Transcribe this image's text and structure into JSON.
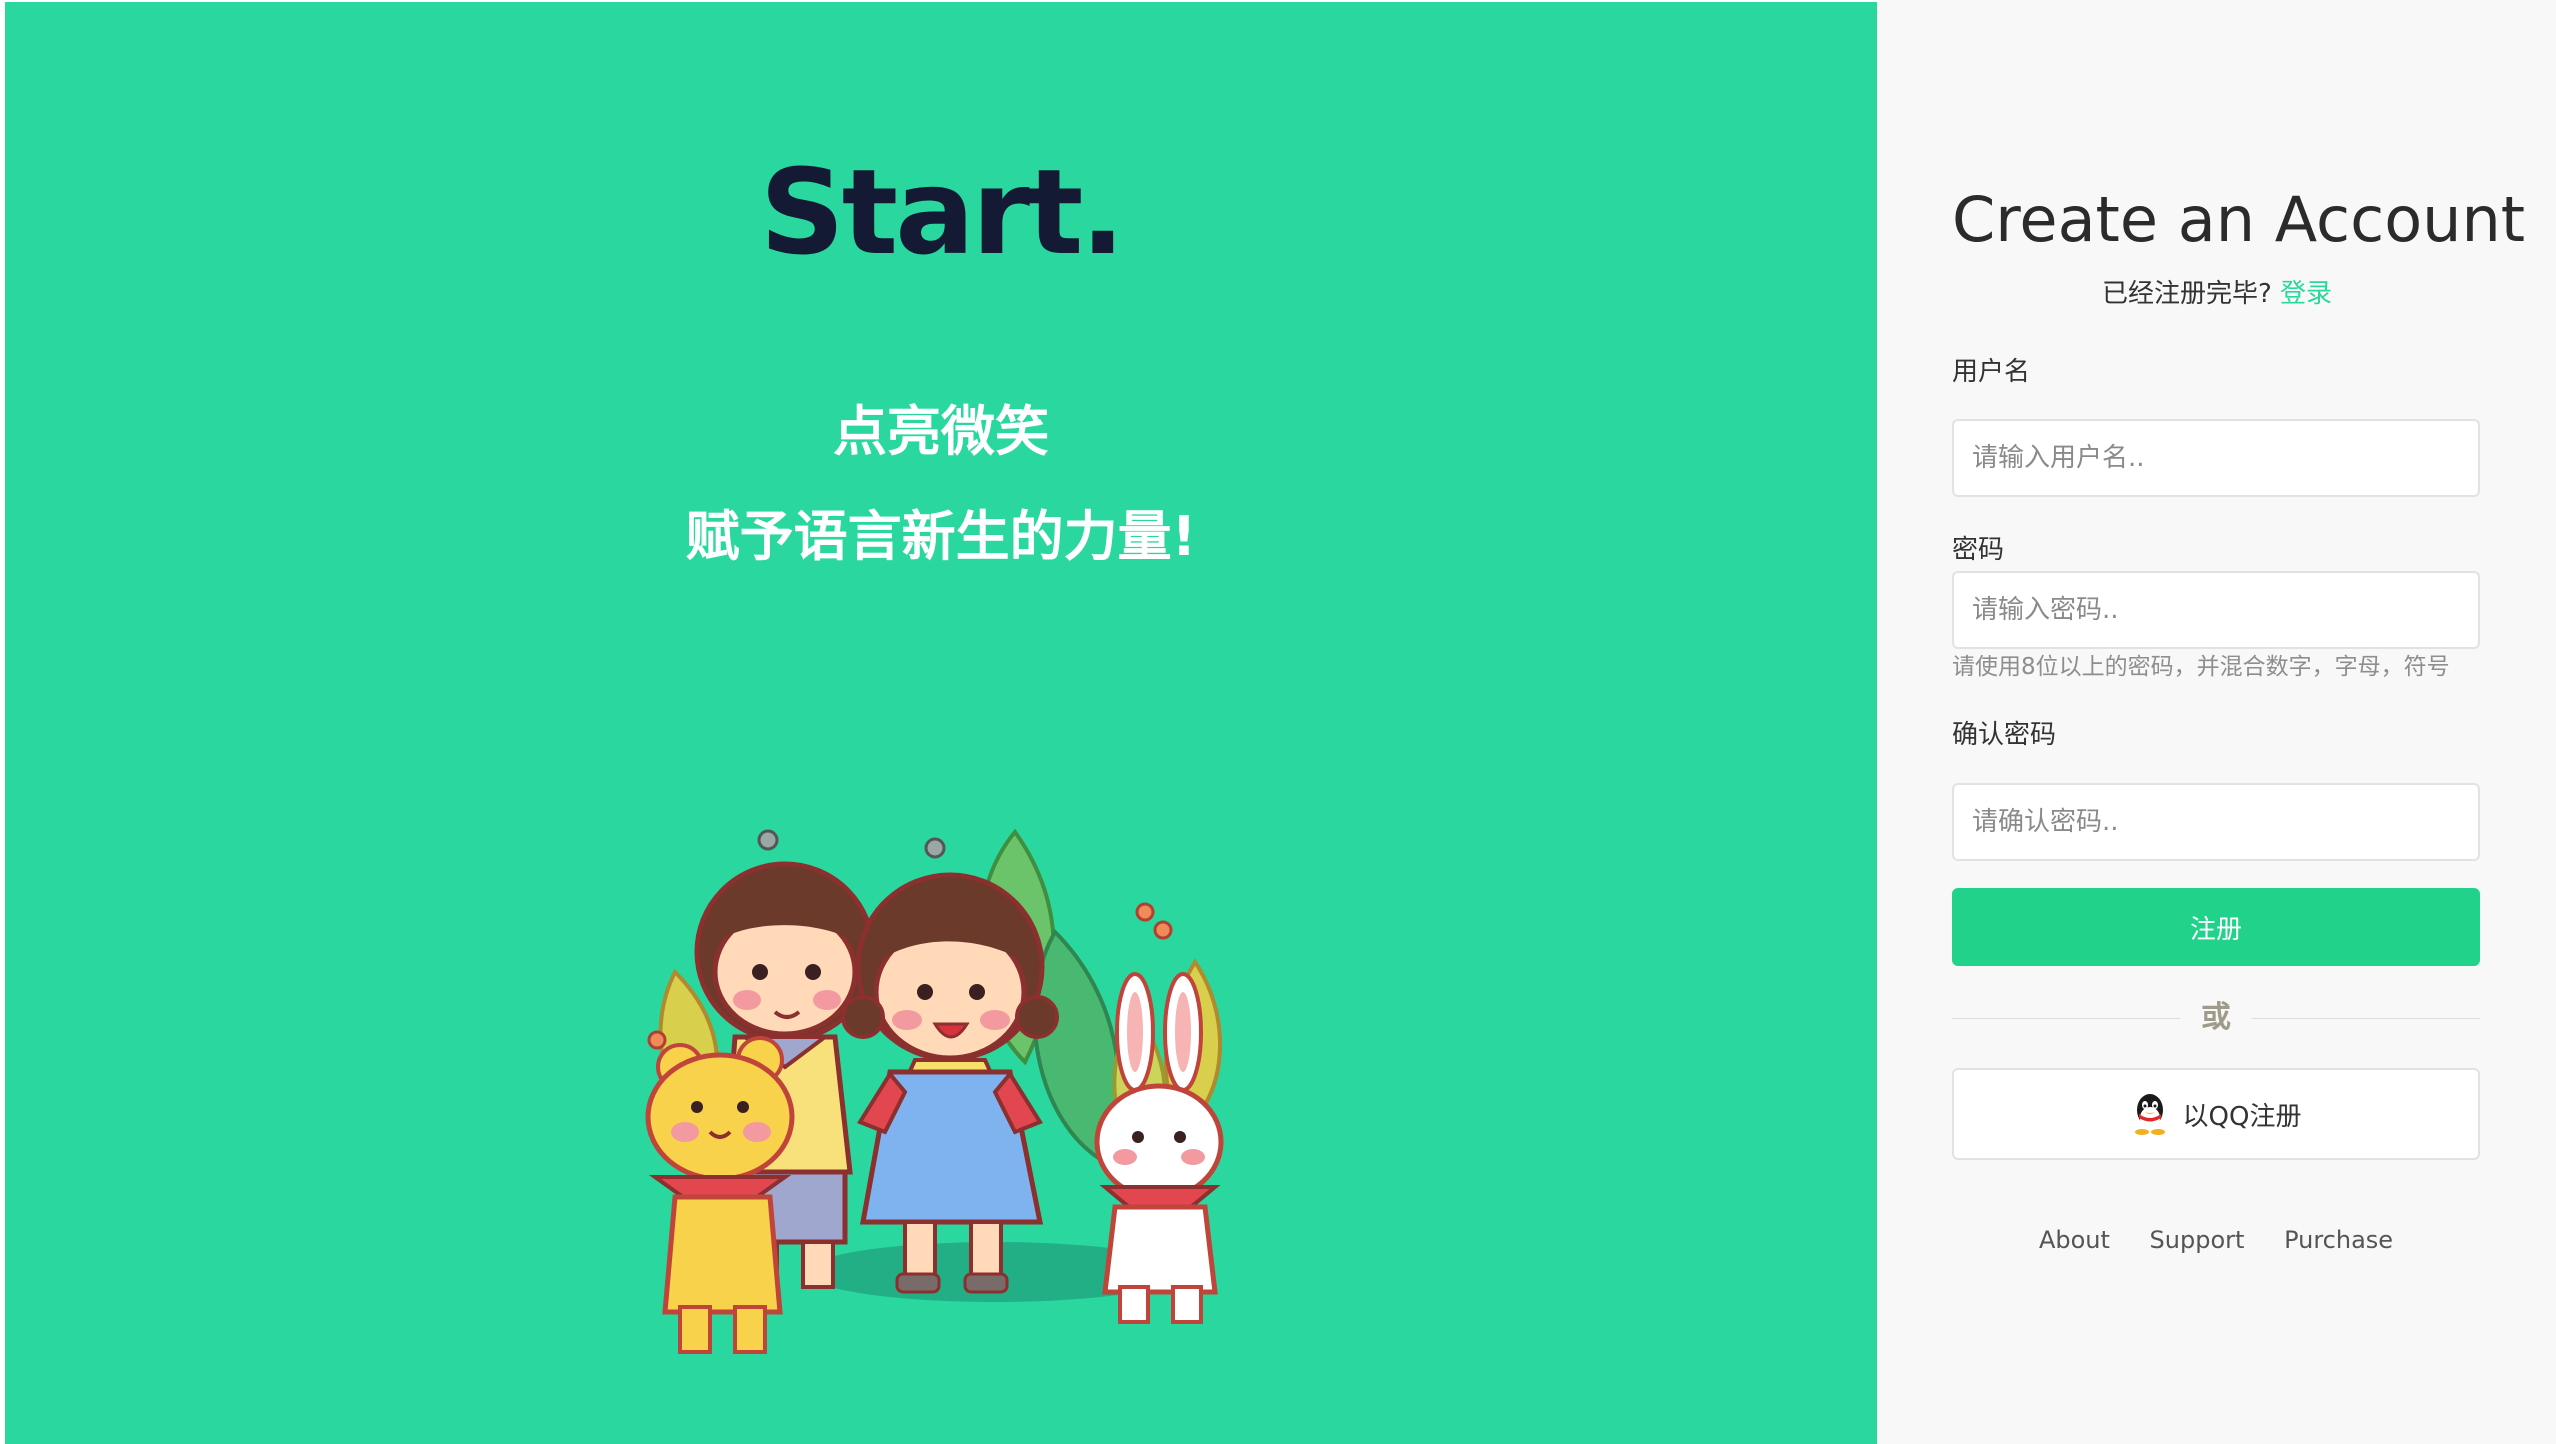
{
  "left_panel": {
    "brand": "Start.",
    "slogan_line1": "点亮微笑",
    "slogan_line2": "赋予语言新生的力量!",
    "background_color": "#2ad79e",
    "illustration": "children-and-animals-illustration"
  },
  "form": {
    "title": "Create an Account",
    "already_registered_text": "已经注册完毕?",
    "login_link": "登录",
    "username_label": "用户名",
    "username_placeholder": "请输入用户名..",
    "password_label": "密码",
    "password_placeholder": "请输入密码..",
    "password_hint": "请使用8位以上的密码，并混合数字，字母，符号",
    "confirm_label": "确认密码",
    "confirm_placeholder": "请确认密码..",
    "submit_label": "注册",
    "or_text": "或",
    "qq_button_label": "以QQ注册",
    "qq_icon": "qq-penguin-icon",
    "accent_color": "#21d38a"
  },
  "footer": {
    "links": [
      "About",
      "Support",
      "Purchase"
    ]
  }
}
